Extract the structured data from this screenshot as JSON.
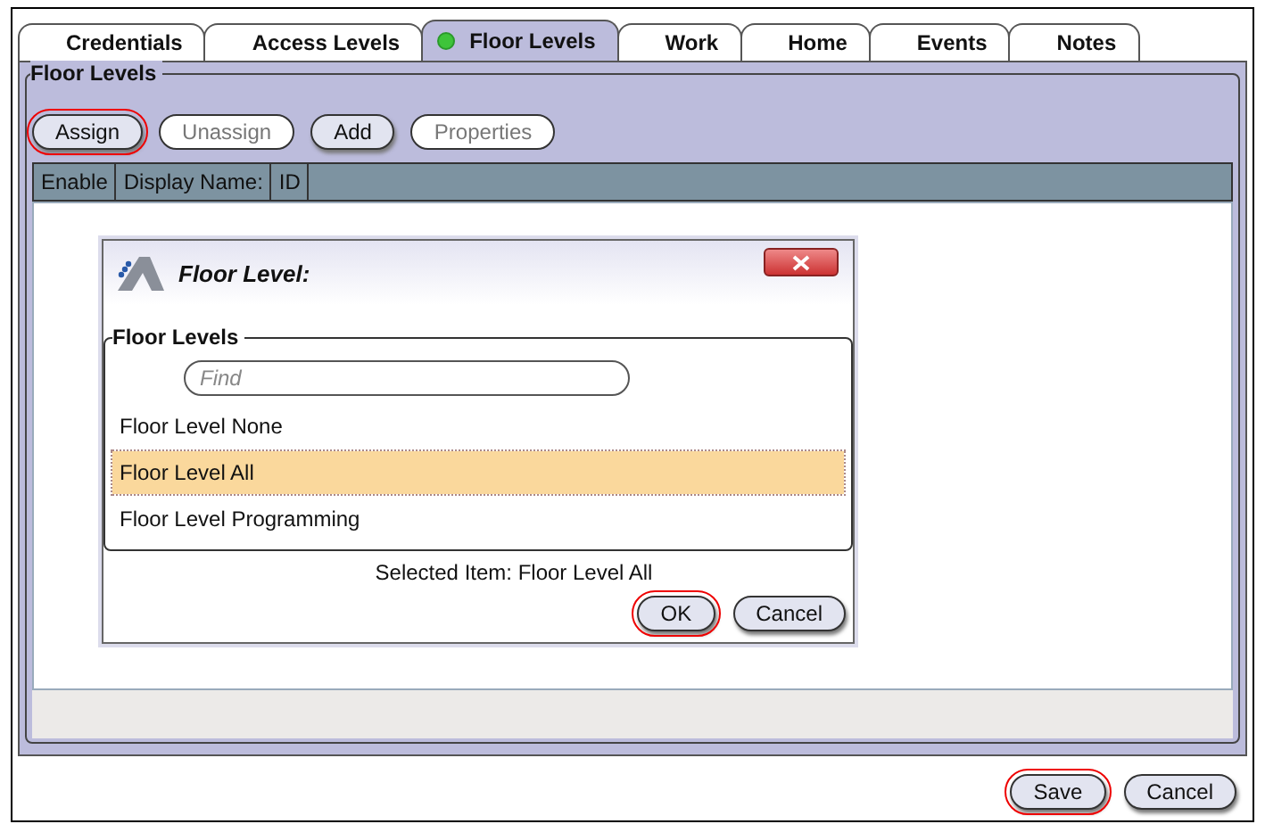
{
  "tabs": [
    {
      "label": "Credentials",
      "selected": false,
      "status_dot": false
    },
    {
      "label": "Access Levels",
      "selected": false,
      "status_dot": false
    },
    {
      "label": "Floor Levels",
      "selected": true,
      "status_dot": true
    },
    {
      "label": "Work",
      "selected": false,
      "status_dot": false
    },
    {
      "label": "Home",
      "selected": false,
      "status_dot": false
    },
    {
      "label": "Events",
      "selected": false,
      "status_dot": false
    },
    {
      "label": "Notes",
      "selected": false,
      "status_dot": false
    }
  ],
  "group": {
    "title": "Floor Levels",
    "toolbar": [
      {
        "label": "Assign",
        "disabled": false,
        "highlighted": true
      },
      {
        "label": "Unassign",
        "disabled": true,
        "highlighted": false
      },
      {
        "label": "Add",
        "disabled": false,
        "highlighted": false
      },
      {
        "label": "Properties",
        "disabled": true,
        "highlighted": false
      }
    ],
    "table": {
      "columns": [
        "Enable",
        "Display Name:",
        "ID"
      ]
    }
  },
  "dialog": {
    "title": "Floor Level:",
    "group_title": "Floor Levels",
    "search": {
      "placeholder": "Find"
    },
    "items": [
      {
        "label": "Floor Level None",
        "selected": false
      },
      {
        "label": "Floor Level All",
        "selected": true
      },
      {
        "label": "Floor Level Programming",
        "selected": false
      }
    ],
    "status": "Selected Item: Floor Level All",
    "buttons": [
      {
        "label": "OK",
        "highlighted": true
      },
      {
        "label": "Cancel",
        "highlighted": false
      }
    ]
  },
  "footer_buttons": [
    {
      "label": "Save",
      "highlighted": true
    },
    {
      "label": "Cancel",
      "highlighted": false
    }
  ]
}
